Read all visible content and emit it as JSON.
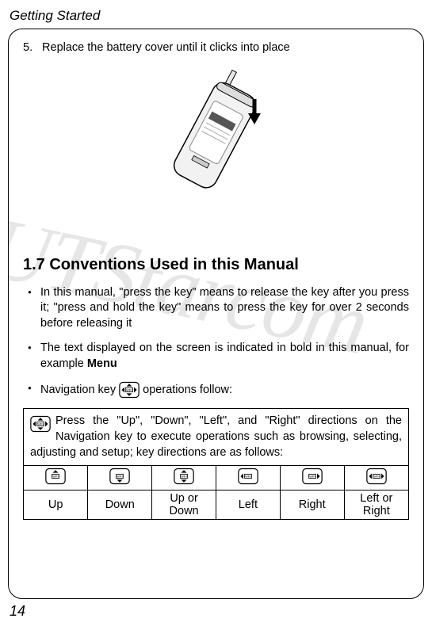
{
  "header": "Getting Started",
  "step": {
    "num": "5.",
    "text": "Replace the battery cover until it clicks into place"
  },
  "sectionTitle": "1.7 Conventions Used in this Manual",
  "bullets": {
    "b1a": "In this manual, \"press the key\" means to release the key after you press it; \"press and hold the key\" means to press the key for over 2 seconds before releasing it",
    "b2a": "The text displayed on the screen is indicated in bold in this manual, for example ",
    "b2b": "Menu",
    "b3a": "Navigation key ",
    "b3b": " operations follow:"
  },
  "dirDesc": " Press the \"Up\", \"Down\", \"Left\", and \"Right\" directions on the Navigation key to execute operations such as browsing, selecting, adjusting and setup; key directions are as follows:",
  "dirs": {
    "up": "Up",
    "down": "Down",
    "updown": "Up or Down",
    "left": "Left",
    "right": "Right",
    "leftright": "Left or Right"
  },
  "pageNum": "14"
}
